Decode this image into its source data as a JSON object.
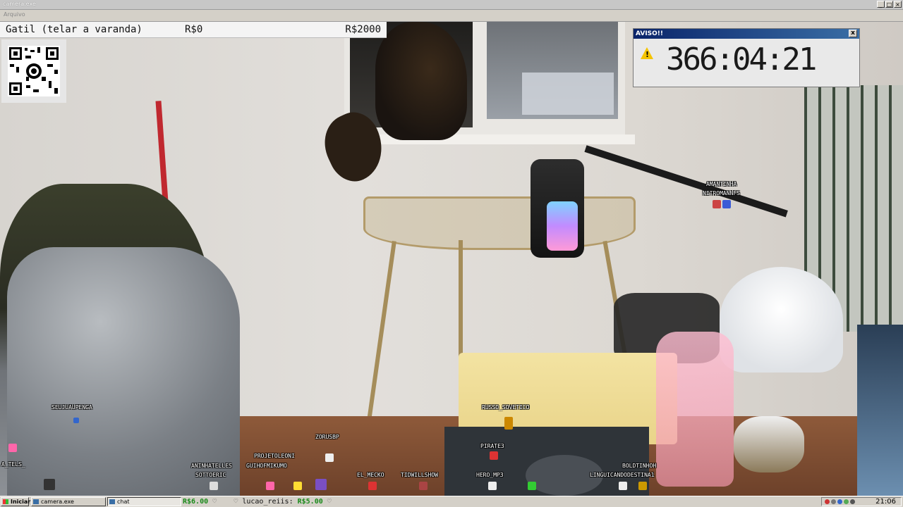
{
  "window": {
    "title": "camera.exe",
    "menu_item": "Arquivo"
  },
  "infobar": {
    "goal": "Gatil (telar a varanda)",
    "current": "R$0",
    "target": "R$2000"
  },
  "aviso": {
    "title": "AVISO!!",
    "timer": "366:04:21",
    "close": "x",
    "warn_mark": "!"
  },
  "chatters": [
    {
      "name": "AMANTINHA",
      "color": "#d44"
    },
    {
      "name": "NITROMANNFS",
      "color": "#d44"
    },
    {
      "name": "SEUJUAUPENGA",
      "color": "#36c"
    },
    {
      "name": "A_TELS_",
      "color": "#f6a"
    },
    {
      "name": "ZORUSBP",
      "color": "#eee"
    },
    {
      "name": "PROJETOLEONI",
      "color": "#c7a"
    },
    {
      "name": "GUIHOFMIKUMO",
      "color": "#f6a"
    },
    {
      "name": "ANINHATELLES",
      "color": "#777"
    },
    {
      "name": "SOTTOERIC",
      "color": "#e8e8e8"
    },
    {
      "name": "EL_MECKO",
      "color": "#d33"
    },
    {
      "name": "TIDWILLSHOW",
      "color": "#a44"
    },
    {
      "name": "RUSSO_SOVETICO",
      "color": "#c80"
    },
    {
      "name": "PIRATE3",
      "color": "#d33"
    },
    {
      "name": "HERO_MP3",
      "color": "#eee"
    },
    {
      "name": "BOLDTINHOH",
      "color": "#c90"
    },
    {
      "name": "LINGUICANDODESTINA1",
      "color": "#e8e8e8"
    }
  ],
  "taskbar": {
    "start": "Iniciar",
    "task_camera": "camera.exe",
    "task_chat": "chat",
    "ticker": [
      {
        "amount": "R$6.00",
        "heart": "♡"
      },
      {
        "name": "lucao_reiis:",
        "amount": "R$5.00",
        "heart": "♡"
      }
    ],
    "clock": "21:06"
  },
  "colors": {
    "accent_title": "#0a246a",
    "ticker_amount": "#1a8a1a",
    "warning": "#f5c400"
  }
}
